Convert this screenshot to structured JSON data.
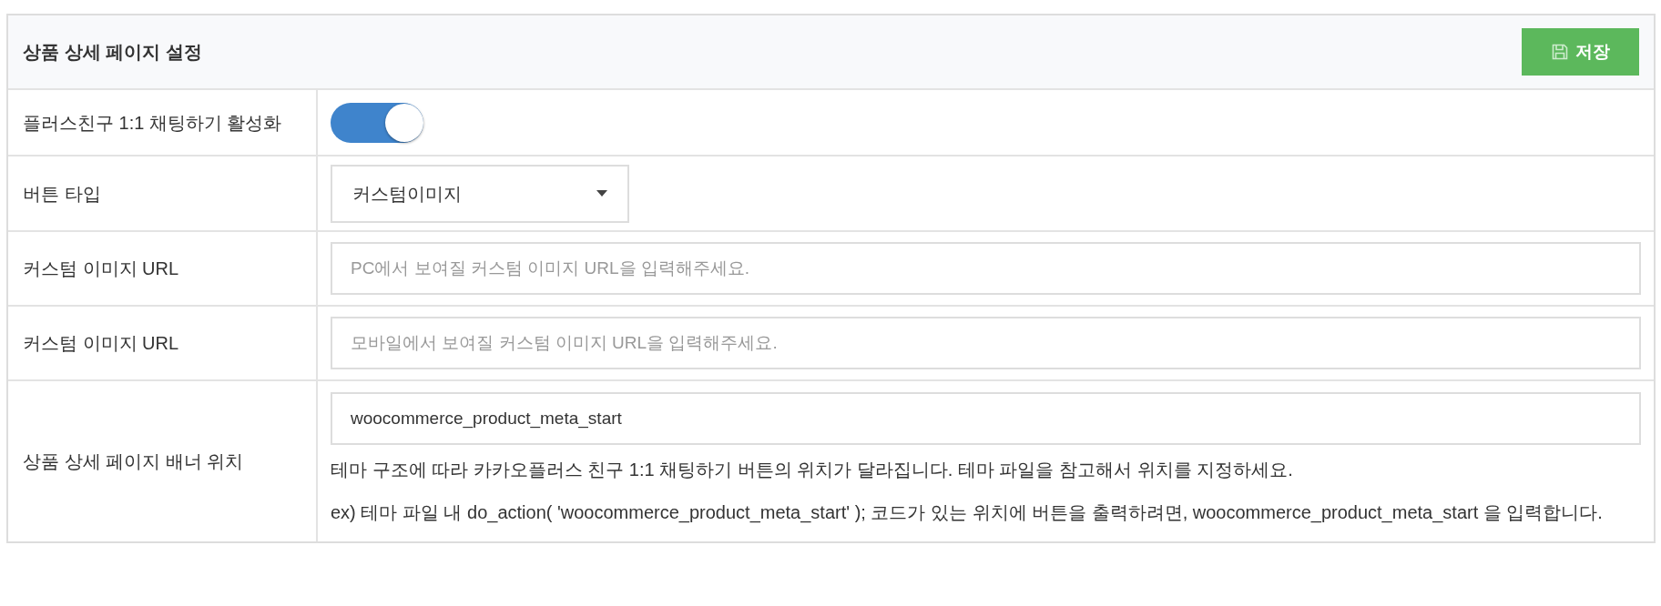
{
  "panel": {
    "title": "상품 상세 페이지 설정",
    "save_button": {
      "label": "저장"
    }
  },
  "rows": [
    {
      "kind": "toggle",
      "label": "플러스친구 1:1 채팅하기 활성화",
      "on": true
    },
    {
      "kind": "select",
      "label": "버튼 타입",
      "value": "커스텀이미지"
    },
    {
      "kind": "text",
      "label": "커스텀 이미지 URL",
      "placeholder": "PC에서 보여질 커스텀 이미지 URL을 입력해주세요."
    },
    {
      "kind": "text",
      "label": "커스텀 이미지 URL",
      "placeholder": "모바일에서 보여질 커스텀 이미지 URL을 입력해주세요."
    },
    {
      "kind": "text",
      "label": "상품 상세 페이지 배너 위치",
      "value": "woocommerce_product_meta_start",
      "help": [
        "테마 구조에 따라 카카오플러스 친구 1:1 채팅하기 버튼의 위치가 달라집니다. 테마 파일을 참고해서 위치를 지정하세요.",
        "ex) 테마 파일 내 do_action( 'woocommerce_product_meta_start' ); 코드가 있는 위치에 버튼을 출력하려면, woocommerce_product_meta_start 을 입력합니다."
      ]
    }
  ]
}
